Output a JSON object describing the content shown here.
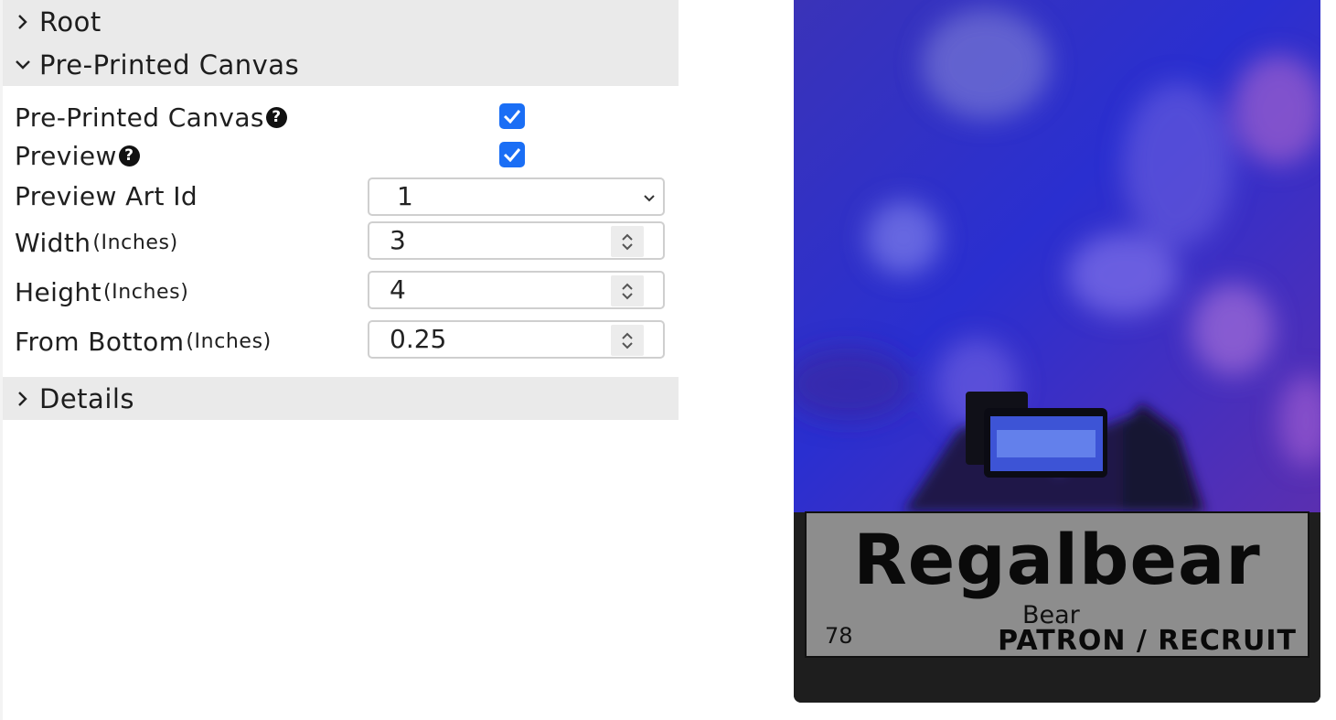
{
  "sections": {
    "root": {
      "title": "Root",
      "expanded": false
    },
    "pre_printed_canvas": {
      "title": "Pre-Printed Canvas",
      "expanded": true
    },
    "details": {
      "title": "Details",
      "expanded": false
    }
  },
  "form": {
    "pre_printed_canvas": {
      "label": "Pre-Printed Canvas",
      "checked": true
    },
    "preview": {
      "label": "Preview",
      "checked": true
    },
    "preview_art_id": {
      "label": "Preview Art Id",
      "value": "1"
    },
    "width": {
      "label": "Width",
      "unit": "(Inches)",
      "value": "3"
    },
    "height": {
      "label": "Height",
      "unit": "(Inches)",
      "value": "4"
    },
    "from_bottom": {
      "label": "From Bottom",
      "unit": "(Inches)",
      "value": "0.25"
    }
  },
  "card_preview": {
    "name": "Regalbear",
    "species": "Bear",
    "number": "78",
    "role": "PATRON / RECRUIT"
  },
  "icons": {
    "chevron_collapsed": "chevron-right-icon",
    "chevron_expanded": "chevron-down-icon",
    "help": "question-circle-icon",
    "check": "check-icon"
  },
  "colors": {
    "checkbox": "#1a6ef5",
    "section_header_bg": "#eaeaea",
    "nameplate_bg": "#8d8d8d"
  }
}
